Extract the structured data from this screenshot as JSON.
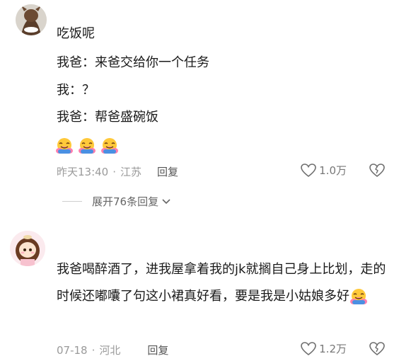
{
  "comment1": {
    "lines": [
      "吃饭呢",
      "我爸：来爸交给你一个任务",
      "我：？",
      "我爸：帮爸盛碗饭"
    ],
    "emoji_count": 3,
    "emoji_icon": "hugging-face-emoji",
    "time": "昨天13:40",
    "location": "江苏",
    "reply_label": "回复",
    "likes": "1.0万"
  },
  "expand_label": "展开76条回复",
  "comment2": {
    "text": "我爸喝醉酒了，进我屋拿着我的jk就搁自己身上比划，走的时候还嘟囔了句这小裙真好看，要是我是小姑娘多好",
    "emoji_icon": "hugging-face-emoji",
    "time": "07-18",
    "location": "河北",
    "reply_label": "回复",
    "likes": "1.2万"
  },
  "colors": {
    "meta_text": "#9a9a9a",
    "body_text": "#1a1a1a",
    "emoji_yellow": "#ffc93a",
    "emoji_blue": "#4a90e2"
  }
}
